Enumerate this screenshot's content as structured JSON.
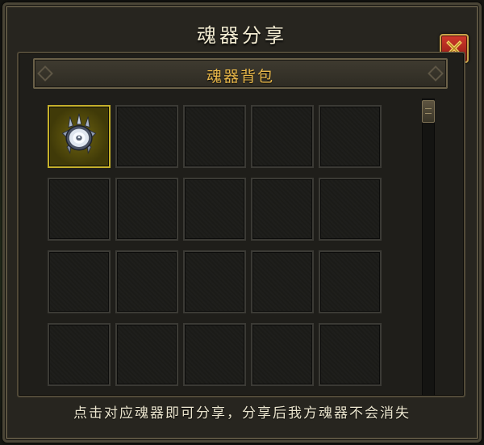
{
  "window": {
    "title": "魂器分享",
    "close_label": "X"
  },
  "panel": {
    "header": "魂器背包",
    "grid": {
      "columns": 5,
      "rows_visible": 4,
      "slots": [
        {
          "filled": true,
          "item_icon": "soul-artifact-icon"
        },
        {
          "filled": false
        },
        {
          "filled": false
        },
        {
          "filled": false
        },
        {
          "filled": false
        },
        {
          "filled": false
        },
        {
          "filled": false
        },
        {
          "filled": false
        },
        {
          "filled": false
        },
        {
          "filled": false
        },
        {
          "filled": false
        },
        {
          "filled": false
        },
        {
          "filled": false
        },
        {
          "filled": false
        },
        {
          "filled": false
        },
        {
          "filled": false
        },
        {
          "filled": false
        },
        {
          "filled": false
        },
        {
          "filled": false
        },
        {
          "filled": false
        }
      ]
    }
  },
  "hint_text": "点击对应魂器即可分享，分享后我方魂器不会消失",
  "colors": {
    "title": "#f3ecd2",
    "header": "#e9b84a",
    "close_bg": "#c0392b",
    "slot_highlight": "#c5b02a"
  }
}
